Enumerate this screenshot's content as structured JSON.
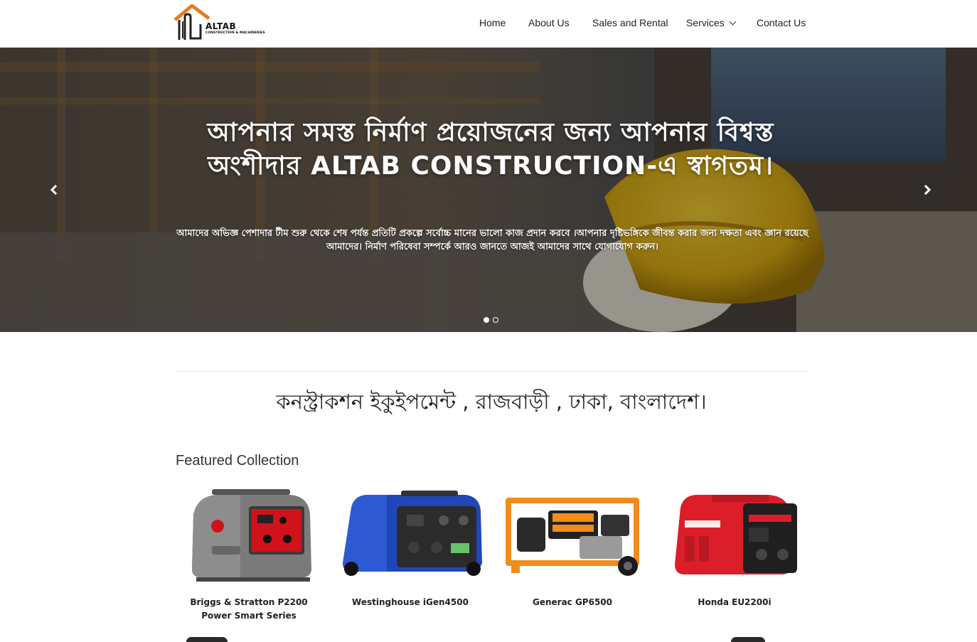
{
  "brand": {
    "name": "ALTAB",
    "tagline": "CONSTRUCTION & MACHINERIES",
    "accent_color": "#e67e22"
  },
  "nav": {
    "items": [
      {
        "label": "Home"
      },
      {
        "label": "About Us"
      },
      {
        "label": "Sales and Rental"
      },
      {
        "label": "Services"
      },
      {
        "label": "Contact Us"
      }
    ]
  },
  "hero": {
    "title": "আপনার সমস্ত নির্মাণ প্রয়োজনের জন্য আপনার বিশ্বস্ত অংশীদার ALTAB CONSTRUCTION-এ স্বাগতম।",
    "subtitle": "আমাদের অভিজ্ঞ পেশাদার টীম শুরু থেকে শেষ পর্যন্ত প্রতিটি প্রকল্পে সর্বোচ্চ মানের ভালো কাজ প্রদান করবে ।আপনার দৃষ্টিভঙ্গিকে জীবন্ত করার জন্য দক্ষতা এবং জ্ঞান রয়েছে আমাদের। নির্মাণ পরিষেবা সম্পর্কে আরও জানতে আজই আমাদের সাথে যোগাযোগ করুন।",
    "slide_count": 2,
    "active_slide": 1
  },
  "location_tagline": "কনস্ট্রাকশন ইকুইপমেন্ট , রাজবাড়ী , ঢাকা, বাংলাদেশ।",
  "featured": {
    "title": "Featured Collection",
    "products": [
      {
        "name": "Briggs & Stratton P2200 Power Smart Series",
        "icon": "generator-gray-icon"
      },
      {
        "name": "Westinghouse iGen4500",
        "icon": "generator-blue-icon"
      },
      {
        "name": "Generac GP6500",
        "icon": "generator-orange-frame-icon"
      },
      {
        "name": "Honda EU2200i",
        "icon": "generator-red-icon"
      }
    ]
  }
}
